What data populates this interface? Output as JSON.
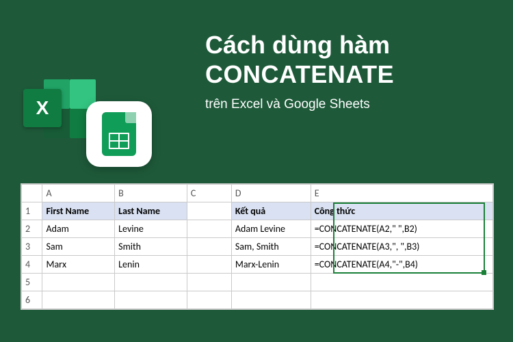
{
  "title": {
    "line1": "Cách dùng hàm",
    "line2": "CONCATENATE",
    "subtitle": "trên Excel và Google Sheets"
  },
  "icons": {
    "excel_letter": "X"
  },
  "spreadsheet": {
    "columns": [
      "A",
      "B",
      "C",
      "D",
      "E"
    ],
    "rows": [
      "1",
      "2",
      "3",
      "4",
      "5",
      "6"
    ],
    "headers": {
      "a": "First Name",
      "b": "Last Name",
      "d": "Kết quả",
      "e": "Công thức"
    },
    "data": [
      {
        "a": "Adam",
        "b": "Levine",
        "d": "Adam Levine",
        "e": "=CONCATENATE(A2,\" \",B2)"
      },
      {
        "a": "Sam",
        "b": "Smith",
        "d": "Sam, Smith",
        "e": "=CONCATENATE(A3,\", \",B3)"
      },
      {
        "a": "Marx",
        "b": "Lenin",
        "d": "Marx-Lenin",
        "e": "=CONCATENATE(A4,\"-\",B4)"
      }
    ]
  }
}
